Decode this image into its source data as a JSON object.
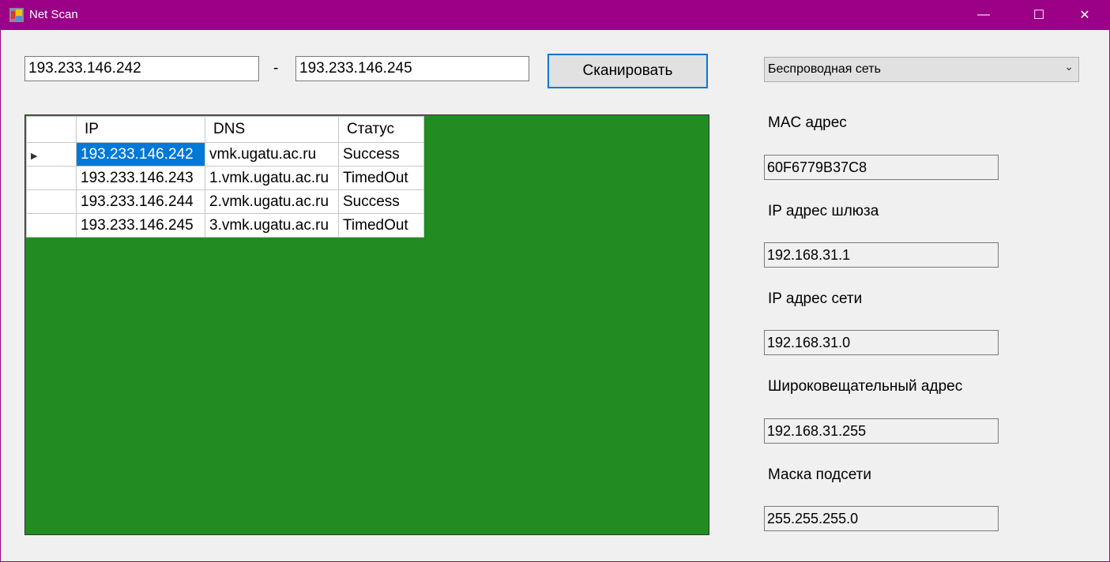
{
  "window": {
    "title": "Net Scan",
    "minimize": "—",
    "maximize": "☐",
    "close": "✕"
  },
  "scan": {
    "from": "193.233.146.242",
    "separator": "-",
    "to": "193.233.146.245",
    "button": "Сканировать"
  },
  "adapter": {
    "selected": "Беспроводная сеть"
  },
  "grid": {
    "columns": [
      "IP",
      "DNS",
      "Статус"
    ],
    "rows": [
      {
        "ip": "193.233.146.242",
        "dns": "vmk.ugatu.ac.ru",
        "status": "Success"
      },
      {
        "ip": "193.233.146.243",
        "dns": "1.vmk.ugatu.ac.ru",
        "status": "TimedOut"
      },
      {
        "ip": "193.233.146.244",
        "dns": "2.vmk.ugatu.ac.ru",
        "status": "Success"
      },
      {
        "ip": "193.233.146.245",
        "dns": "3.vmk.ugatu.ac.ru",
        "status": "TimedOut"
      }
    ]
  },
  "info": [
    {
      "label": "MAC адрес",
      "value": "60F6779B37C8"
    },
    {
      "label": "IP адрес шлюза",
      "value": "192.168.31.1"
    },
    {
      "label": "IP адрес сети",
      "value": "192.168.31.0"
    },
    {
      "label": "Широковещательный адрес",
      "value": "192.168.31.255"
    },
    {
      "label": "Маска подсети",
      "value": "255.255.255.0"
    }
  ]
}
